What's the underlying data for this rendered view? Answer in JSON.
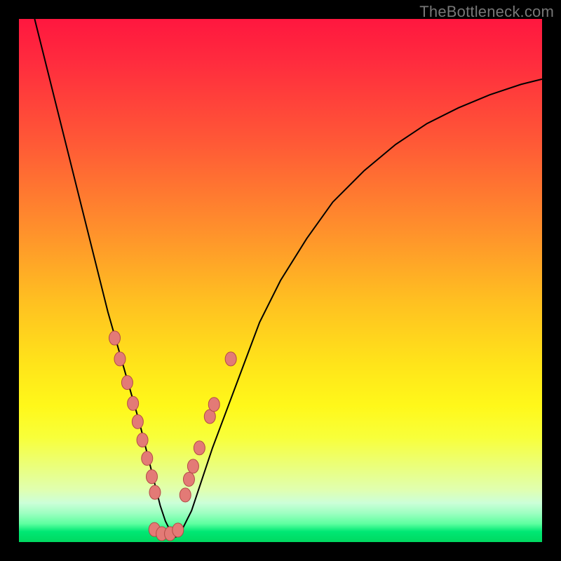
{
  "watermark": "TheBottleneck.com",
  "chart_data": {
    "type": "line",
    "title": "",
    "xlabel": "",
    "ylabel": "",
    "xlim": [
      0,
      100
    ],
    "ylim": [
      0,
      100
    ],
    "x": [
      3,
      5,
      7,
      9,
      11,
      13,
      15,
      17,
      19,
      21,
      23,
      24,
      25,
      26,
      27,
      28,
      29,
      30,
      31,
      33,
      35,
      37,
      40,
      43,
      46,
      50,
      55,
      60,
      66,
      72,
      78,
      84,
      90,
      96,
      100
    ],
    "y": [
      100,
      92,
      84,
      76,
      68,
      60,
      52,
      44,
      37,
      30,
      23,
      19,
      15,
      11,
      7,
      4,
      2,
      1,
      2,
      6,
      12,
      18,
      26,
      34,
      42,
      50,
      58,
      65,
      71,
      76,
      80,
      83,
      85.5,
      87.5,
      88.5
    ],
    "series": [
      {
        "name": "bottleneck-curve",
        "color": "#000000"
      }
    ],
    "markers": {
      "color": "#e37a76",
      "stroke": "#b24a46",
      "points": [
        {
          "x": 18.3,
          "y": 39.0
        },
        {
          "x": 19.3,
          "y": 35.0
        },
        {
          "x": 20.7,
          "y": 30.5
        },
        {
          "x": 21.8,
          "y": 26.5
        },
        {
          "x": 22.7,
          "y": 23.0
        },
        {
          "x": 23.6,
          "y": 19.5
        },
        {
          "x": 24.5,
          "y": 16.0
        },
        {
          "x": 25.4,
          "y": 12.5
        },
        {
          "x": 26.0,
          "y": 9.5
        },
        {
          "x": 25.9,
          "y": 2.4
        },
        {
          "x": 27.3,
          "y": 1.6
        },
        {
          "x": 28.9,
          "y": 1.6
        },
        {
          "x": 30.4,
          "y": 2.3
        },
        {
          "x": 31.8,
          "y": 9.0
        },
        {
          "x": 32.5,
          "y": 12.0
        },
        {
          "x": 33.3,
          "y": 14.5
        },
        {
          "x": 34.5,
          "y": 18.0
        },
        {
          "x": 36.5,
          "y": 24.0
        },
        {
          "x": 37.3,
          "y": 26.3
        },
        {
          "x": 40.5,
          "y": 35.0
        }
      ]
    },
    "background_gradient": [
      {
        "stop": 0.0,
        "color": "#ff173f"
      },
      {
        "stop": 0.4,
        "color": "#ff8f2c"
      },
      {
        "stop": 0.7,
        "color": "#fff81a"
      },
      {
        "stop": 0.9,
        "color": "#e0ffb0"
      },
      {
        "stop": 1.0,
        "color": "#00d860"
      }
    ]
  }
}
